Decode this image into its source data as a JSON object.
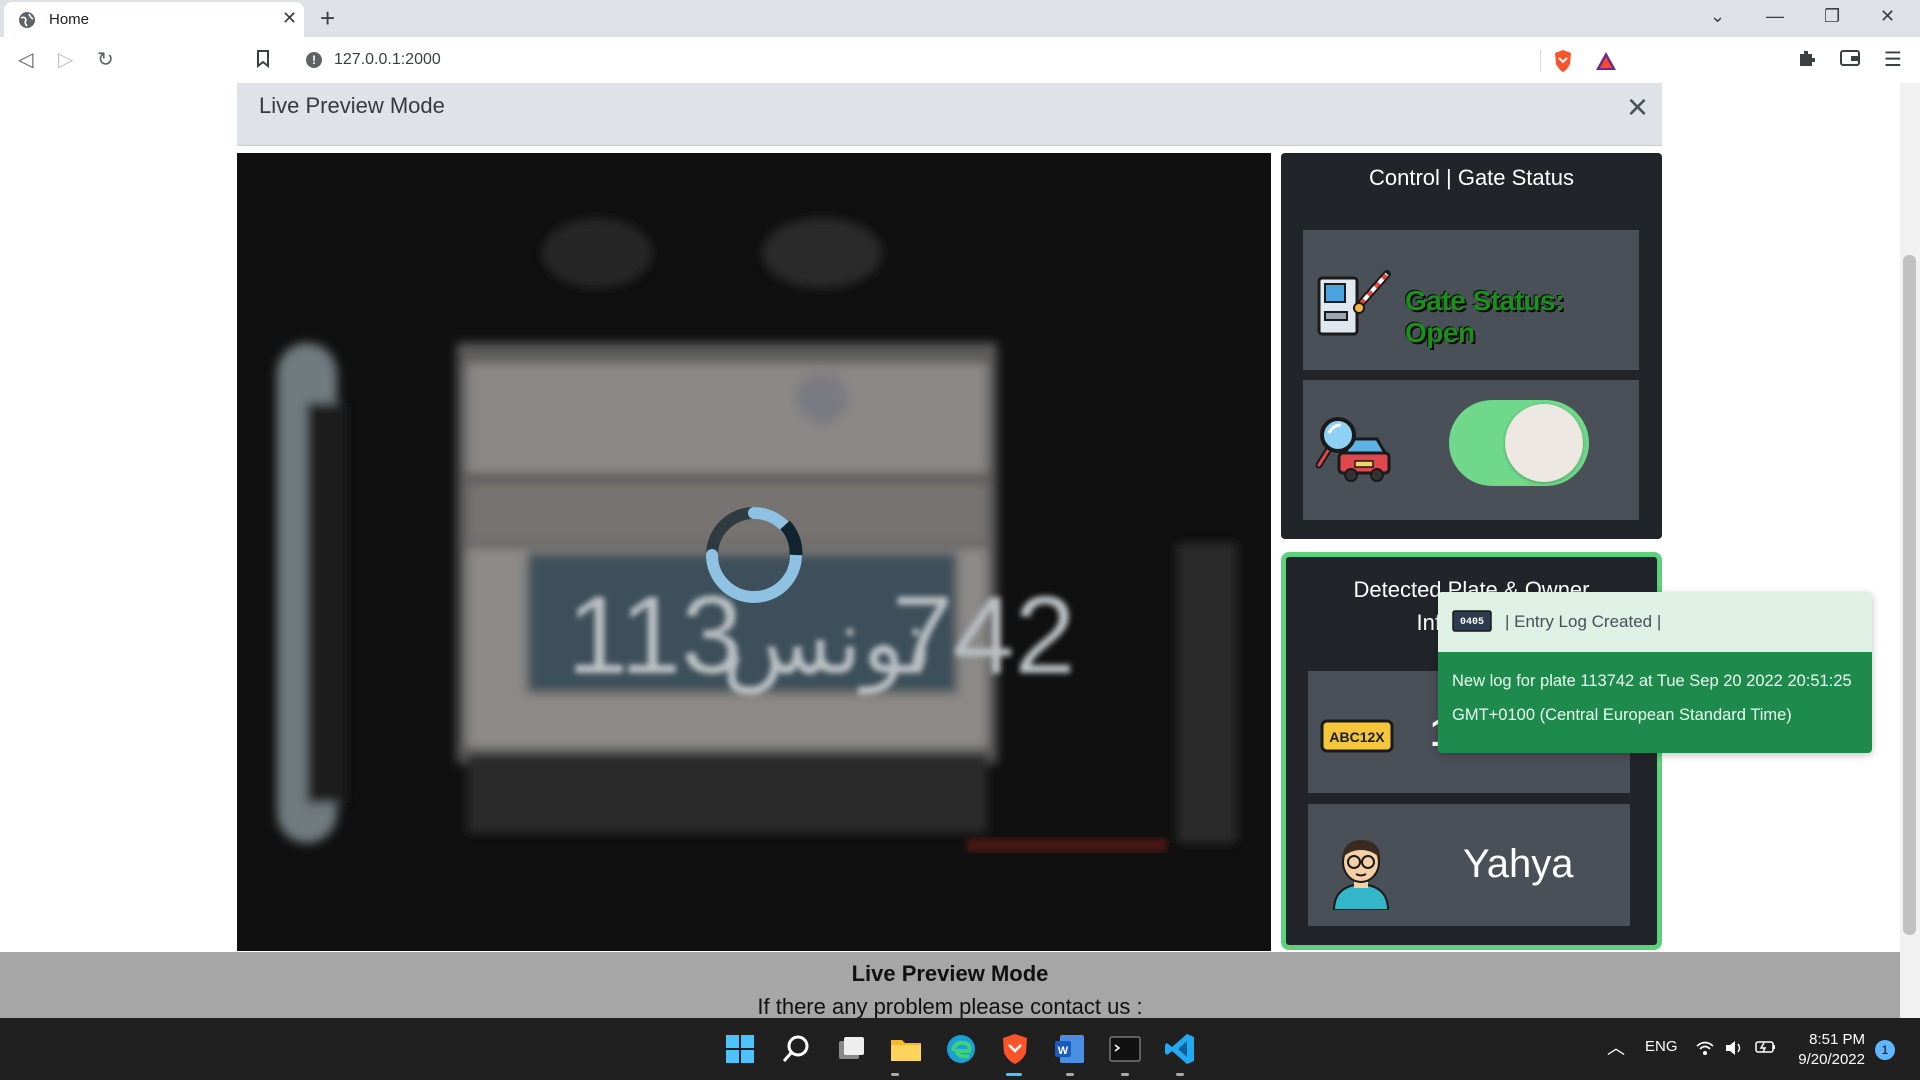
{
  "browser": {
    "tab_title": "Home",
    "url": "127.0.0.1:2000"
  },
  "modal": {
    "title": "Live Preview Mode",
    "close_symbol": "×"
  },
  "camera": {
    "plate_text_left": "113",
    "plate_text_arabic": "تونس",
    "plate_text_right": "742",
    "loading": true
  },
  "control_panel": {
    "title": "Control | Gate Status",
    "gate_status": "Gate Status: Open",
    "gate_status_color": "#1a8f1a",
    "detection_toggle_on": true,
    "toggle_color": "#6fd88a"
  },
  "plate_panel": {
    "title_line1": "Detected Plate & Owner",
    "title_line2": "Information",
    "plate_icon_text": "ABC12X",
    "owner_name": "Yahya",
    "border_color": "#5cd07a"
  },
  "toast": {
    "icon_text": "0405",
    "header": "| Entry Log Created |",
    "body_line1": "New log for plate 113742 at Tue Sep 20 2022 20:51:25",
    "body_line2": "GMT+0100 (Central European Standard Time)",
    "body_color": "#1e8a4c"
  },
  "footer": {
    "title": "Live Preview Mode",
    "contact": "If there any problem please contact us :"
  },
  "taskbar": {
    "lang": "ENG",
    "time": "8:51 PM",
    "date": "9/20/2022",
    "notification_count": "1"
  }
}
